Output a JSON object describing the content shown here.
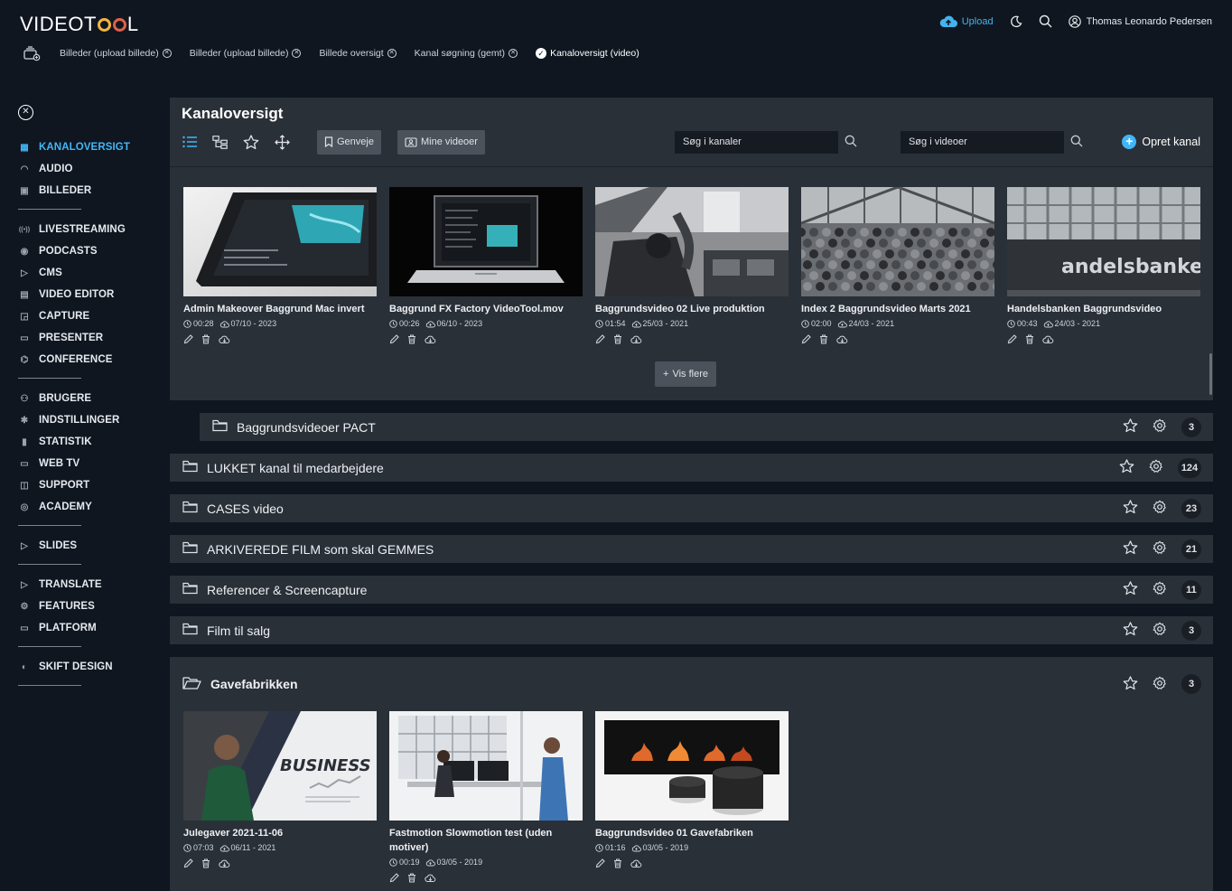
{
  "app": {
    "logo_text": "VIDEOTOOL",
    "upload_label": "Upload",
    "user_name": "Thomas Leonardo Pedersen"
  },
  "tabs": [
    {
      "label": "Billeder (upload billede)",
      "active": false
    },
    {
      "label": "Billeder (upload billede)",
      "active": false
    },
    {
      "label": "Billede oversigt",
      "active": false
    },
    {
      "label": "Kanal søgning (gemt)",
      "active": false
    },
    {
      "label": "Kanaloversigt (video)",
      "active": true
    }
  ],
  "sidebar": {
    "groups": [
      [
        {
          "label": "KANALOVERSIGT",
          "icon": "grid-icon",
          "active": true
        },
        {
          "label": "AUDIO",
          "icon": "headphones-icon"
        },
        {
          "label": "BILLEDER",
          "icon": "image-icon"
        }
      ],
      [
        {
          "label": "LIVESTREAMING",
          "icon": "broadcast-icon"
        },
        {
          "label": "PODCASTS",
          "icon": "podcast-icon"
        },
        {
          "label": "CMS",
          "icon": "cms-icon"
        },
        {
          "label": "VIDEO EDITOR",
          "icon": "film-icon"
        },
        {
          "label": "CAPTURE",
          "icon": "capture-icon"
        },
        {
          "label": "PRESENTER",
          "icon": "presenter-icon"
        },
        {
          "label": "CONFERENCE",
          "icon": "conference-icon"
        }
      ],
      [
        {
          "label": "BRUGERE",
          "icon": "users-icon"
        },
        {
          "label": "INDSTILLINGER",
          "icon": "gear-icon"
        },
        {
          "label": "STATISTIK",
          "icon": "bar-chart-icon"
        },
        {
          "label": "WEB TV",
          "icon": "monitor-icon"
        },
        {
          "label": "SUPPORT",
          "icon": "chat-icon"
        },
        {
          "label": "ACADEMY",
          "icon": "academy-icon"
        }
      ],
      [
        {
          "label": "SLIDES",
          "icon": "slides-icon"
        }
      ],
      [
        {
          "label": "TRANSLATE",
          "icon": "translate-icon"
        },
        {
          "label": "FEATURES",
          "icon": "features-icon"
        },
        {
          "label": "PLATFORM",
          "icon": "platform-icon"
        }
      ],
      [
        {
          "label": "SKIFT DESIGN",
          "icon": "palette-icon"
        }
      ]
    ]
  },
  "main": {
    "title": "Kanaloversigt",
    "shortcut_label": "Genveje",
    "my_videos_label": "Mine videoer",
    "search_channels_placeholder": "Søg i kanaler",
    "search_videos_placeholder": "Søg i videoer",
    "create_channel_label": "Opret kanal",
    "show_more_label": "Vis flere",
    "videos": [
      {
        "title": "Admin Makeover Baggrund Mac invert",
        "duration": "00:28",
        "date": "07/10 - 2023",
        "thumb": "tablet"
      },
      {
        "title": "Baggrund FX Factory VideoTool.mov",
        "duration": "00:26",
        "date": "06/10 - 2023",
        "thumb": "laptop"
      },
      {
        "title": "Baggrundsvideo 02 Live produktion",
        "duration": "01:54",
        "date": "25/03 - 2021",
        "thumb": "studio"
      },
      {
        "title": "Index 2 Baggrundsvideo Marts 2021",
        "duration": "02:00",
        "date": "24/03 - 2021",
        "thumb": "crowd"
      },
      {
        "title": "Handelsbanken Baggrundsvideo",
        "duration": "00:43",
        "date": "24/03 - 2021",
        "thumb": "bank"
      }
    ],
    "subfolder": {
      "name": "Baggrundsvideoer PACT",
      "count": "3"
    },
    "folders": [
      {
        "name": "LUKKET kanal til medarbejdere",
        "count": "124"
      },
      {
        "name": "CASES video",
        "count": "23"
      },
      {
        "name": "ARKIVEREDE FILM som skal GEMMES",
        "count": "21"
      },
      {
        "name": "Referencer & Screencapture",
        "count": "11"
      },
      {
        "name": "Film til salg",
        "count": "3"
      }
    ],
    "open_folder": {
      "name": "Gavefabrikken",
      "count": "3",
      "videos": [
        {
          "title": "Julegaver 2021-11-06",
          "duration": "07:03",
          "date": "06/11 - 2021",
          "thumb": "business"
        },
        {
          "title": "Fastmotion Slowmotion test (uden motiver)",
          "duration": "00:19",
          "date": "03/05 - 2019",
          "thumb": "office"
        },
        {
          "title": "Baggrundsvideo 01 Gavefabriken",
          "duration": "01:16",
          "date": "03/05 - 2019",
          "thumb": "speakers"
        }
      ]
    },
    "thumb_texts": {
      "bank": "andelsbanken",
      "business": "BUSINESS"
    }
  }
}
